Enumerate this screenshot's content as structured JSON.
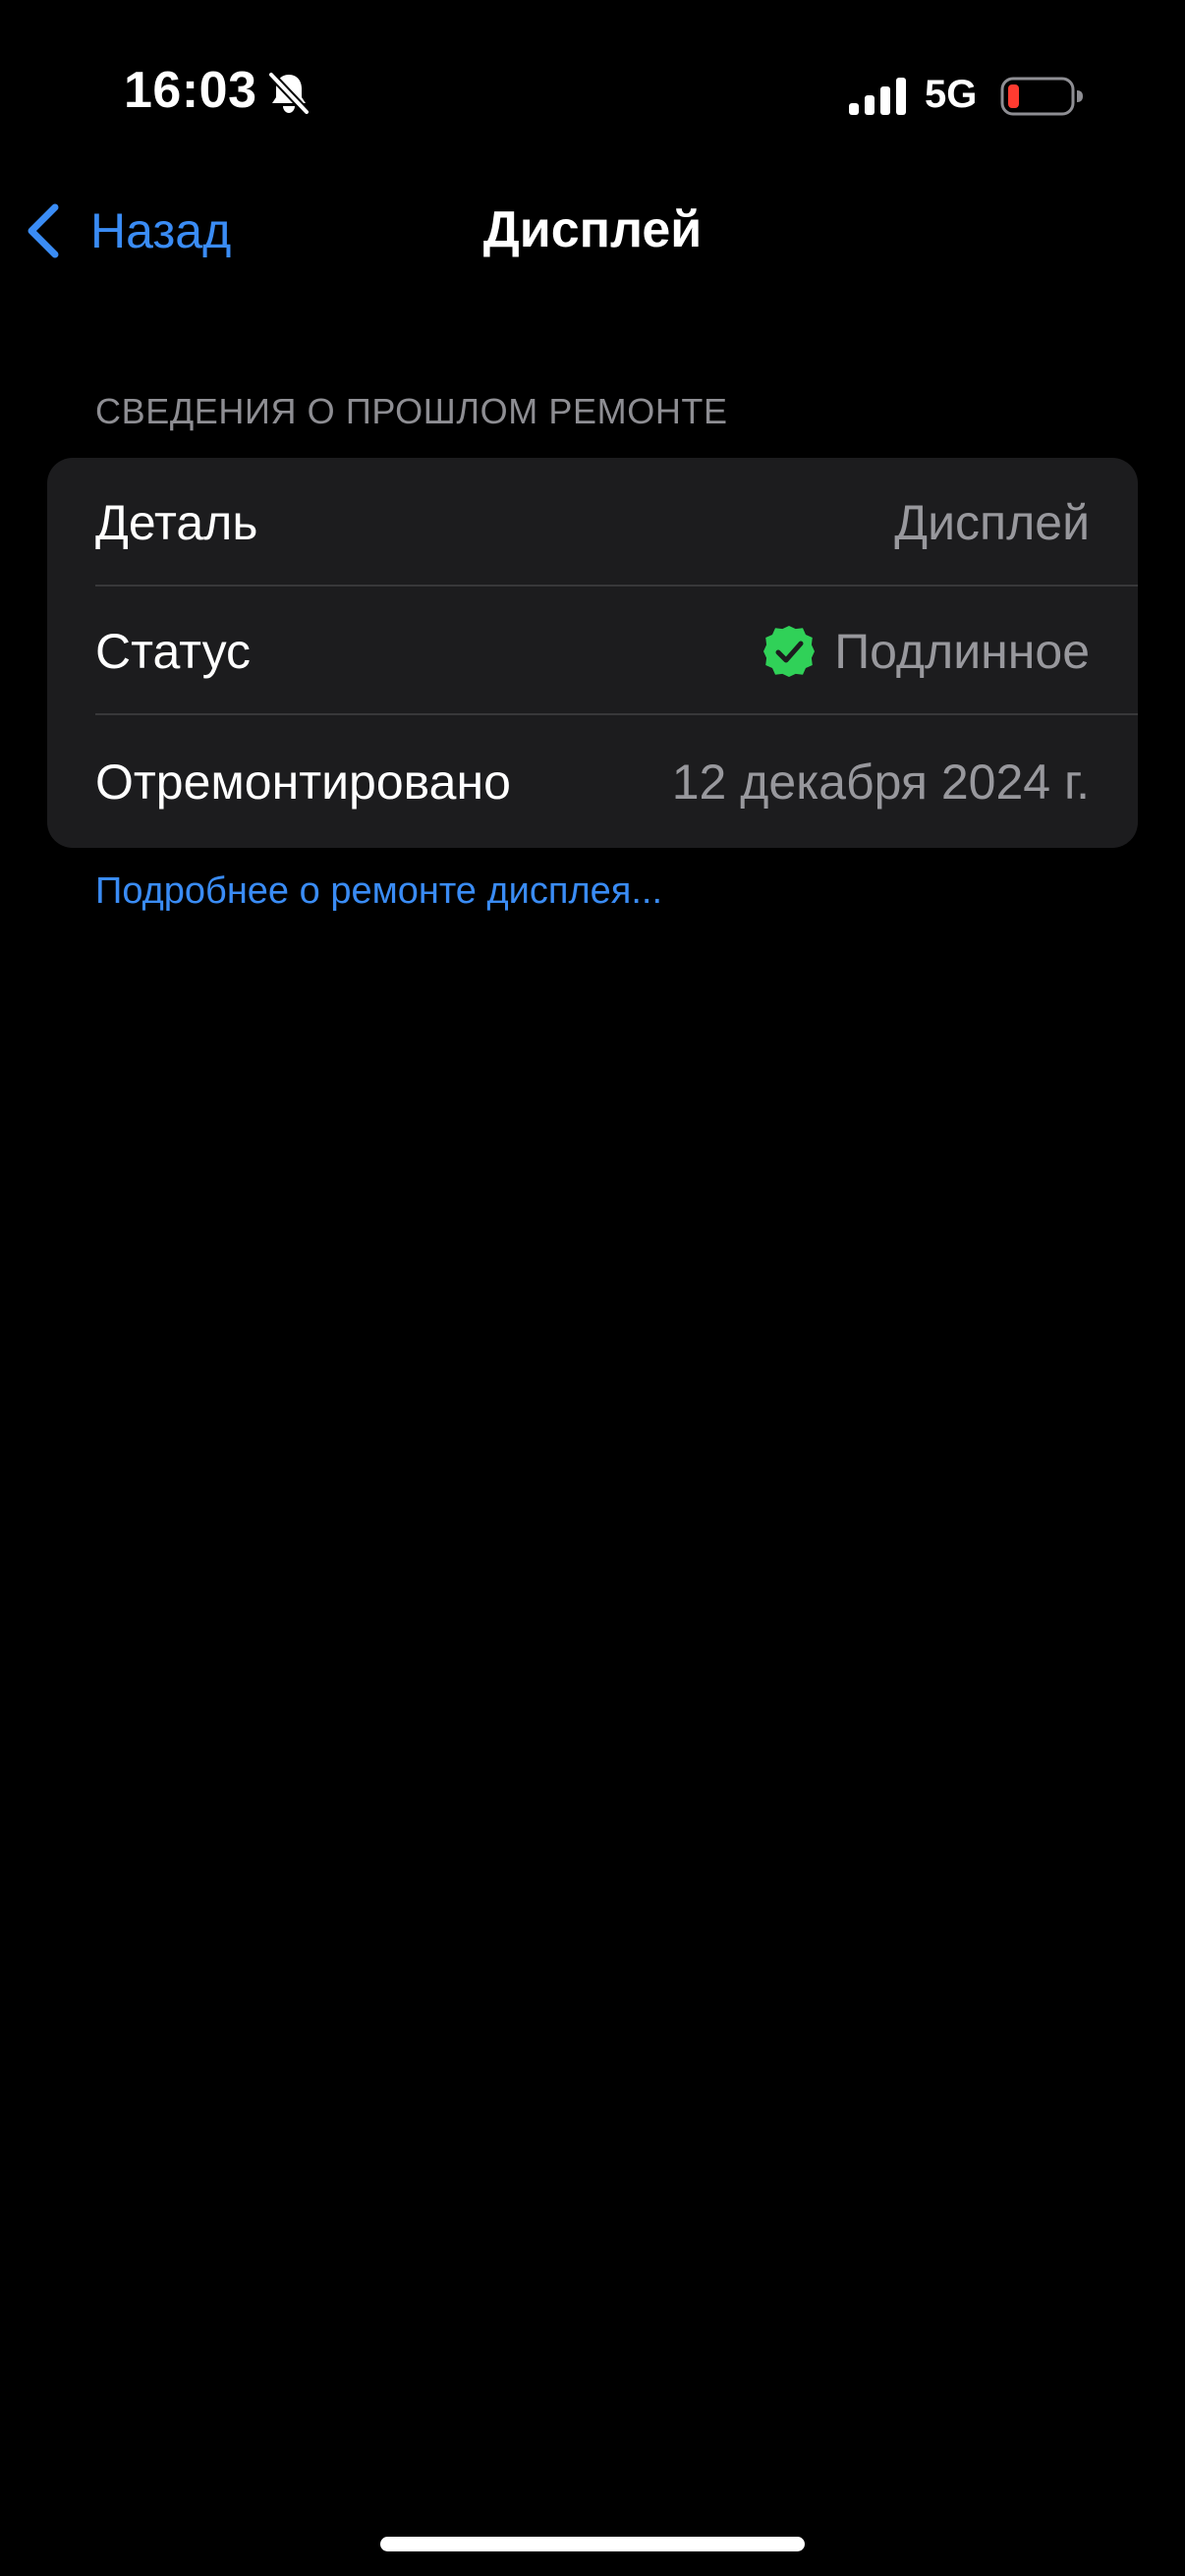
{
  "status_bar": {
    "time": "16:03",
    "network": "5G",
    "icons": {
      "mute": "bell-slash-icon",
      "signal": "cellular-signal-icon",
      "battery": "battery-low-icon"
    },
    "battery_color": "#ff3b30"
  },
  "nav": {
    "back_label": "Назад",
    "back_icon": "chevron-left-icon",
    "title": "Дисплей"
  },
  "section": {
    "header": "СВЕДЕНИЯ О ПРОШЛОМ РЕМОНТЕ",
    "rows": [
      {
        "label": "Деталь",
        "value": "Дисплей"
      },
      {
        "label": "Статус",
        "value": "Подлинное",
        "icon": "verified-check-badge-icon",
        "icon_color": "#30d158"
      },
      {
        "label": "Отремонтировано",
        "value": "12 декабря 2024 г."
      }
    ],
    "footer_link": "Подробнее о ремонте дисплея..."
  },
  "colors": {
    "background": "#000000",
    "group_background": "#1c1c1e",
    "accent": "#3a8cf5",
    "secondary_text": "#98989d"
  }
}
